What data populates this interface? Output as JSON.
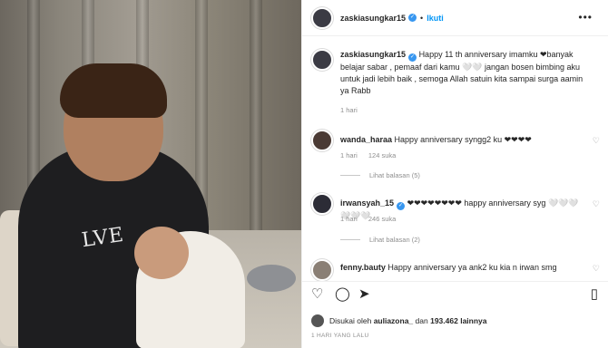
{
  "post": {
    "username": "zaskiasungkar15",
    "follow_label": "Ikuti",
    "more_label": "•••"
  },
  "caption": {
    "username": "zaskiasungkar15",
    "text": "Happy 11 th anniversary imamku ❤banyak belajar sabar , pemaaf dari kamu 🤍🤍 jangan bosen bimbing aku untuk jadi lebih baik , semoga Allah satuin kita sampai surga aamin ya Rabb",
    "time": "1 hari"
  },
  "comments": [
    {
      "username": "wanda_haraa",
      "text": "Happy anniversary syngg2 ku ❤❤❤❤",
      "time": "1 hari",
      "likes": "124 suka",
      "replies": "Lihat balasan (5)"
    },
    {
      "username": "irwansyah_15",
      "text": "❤❤❤❤❤❤❤❤ happy anniversary syg 🤍🤍🤍🤍🤍🤍",
      "time": "1 hari",
      "likes": "246 suka",
      "replies": "Lihat balasan (2)"
    },
    {
      "username": "fenny.bauty",
      "text": "Happy anniversary ya ank2 ku kia n irwan smg"
    }
  ],
  "likes": {
    "prefix": "Disukai oleh",
    "user": "auliazona_",
    "middle": "dan",
    "count": "193.462",
    "suffix": "lainnya"
  },
  "time_ago": "1 HARI YANG LALU",
  "photo": {
    "shirt_text": "LVE"
  },
  "colors": {
    "accent": "#0095f6",
    "verified": "#3897f0"
  },
  "icons": [
    "heart-icon",
    "comment-icon",
    "share-icon",
    "bookmark-icon",
    "more-icon"
  ]
}
